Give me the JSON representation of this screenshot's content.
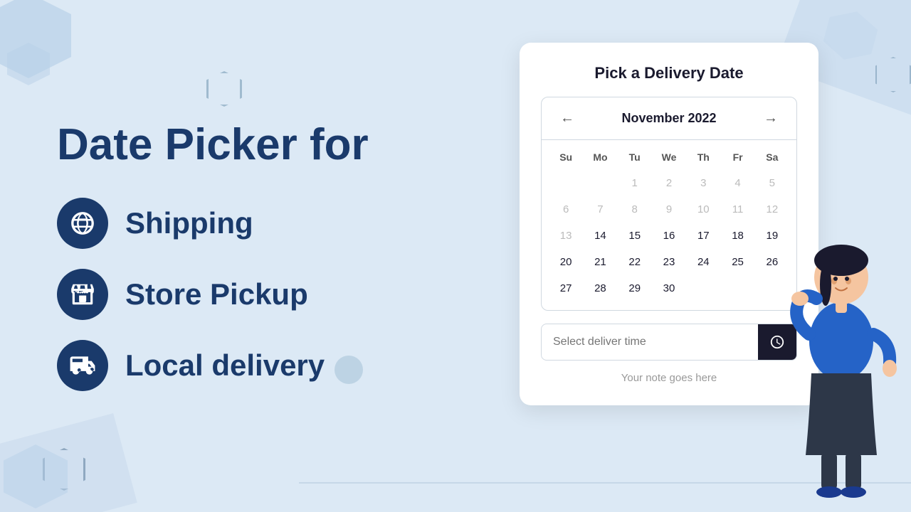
{
  "background": {
    "color": "#dce9f5"
  },
  "left": {
    "title": "Date Picker for",
    "features": [
      {
        "id": "shipping",
        "label": "Shipping",
        "icon": "globe-icon"
      },
      {
        "id": "store-pickup",
        "label": "Store Pickup",
        "icon": "store-icon"
      },
      {
        "id": "local-delivery",
        "label": "Local delivery",
        "icon": "delivery-icon"
      }
    ]
  },
  "card": {
    "title": "Pick a Delivery Date",
    "calendar": {
      "monthYear": "November 2022",
      "prevArrow": "←",
      "nextArrow": "→",
      "dayHeaders": [
        "Su",
        "Mo",
        "Tu",
        "We",
        "Th",
        "Fr",
        "Sa"
      ],
      "weeks": [
        [
          null,
          null,
          "1",
          "2",
          "3",
          "4",
          "5"
        ],
        [
          "6",
          "7",
          "8",
          "9",
          "10",
          "11",
          "12"
        ],
        [
          "13",
          "14",
          "15",
          "16",
          "17",
          "18",
          "19"
        ],
        [
          "20",
          "21",
          "22",
          "23",
          "24",
          "25",
          "26"
        ],
        [
          "27",
          "28",
          "29",
          "30",
          null,
          null,
          null
        ]
      ],
      "mutedDays": [
        "1",
        "2",
        "3",
        "4",
        "5",
        "6",
        "7",
        "8",
        "9",
        "10",
        "11",
        "12",
        "13"
      ],
      "startOffset": 2
    },
    "timePicker": {
      "placeholder": "Select deliver time",
      "icon": "clock-icon"
    },
    "note": "Your note goes here"
  }
}
